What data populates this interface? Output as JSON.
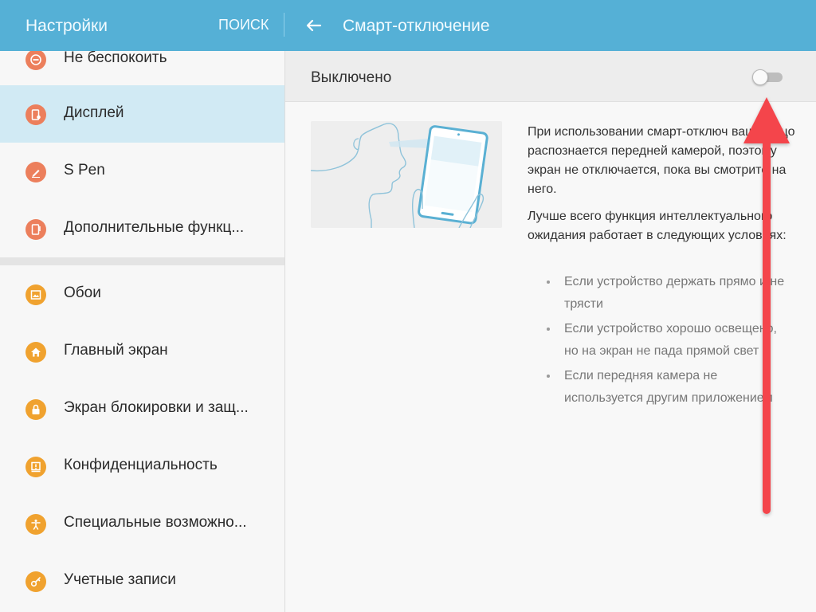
{
  "header": {
    "app_title": "Настройки",
    "search_label": "ПОИСК",
    "page_title": "Смарт-отключение",
    "bg_color": "#55b0d6"
  },
  "sidebar": {
    "items": [
      {
        "label": "Не беспокоить",
        "icon": "do-not-disturb-icon",
        "color": "#ec7f5c"
      },
      {
        "label": "Дисплей",
        "icon": "display-icon",
        "color": "#ec7f5c",
        "active": true
      },
      {
        "label": "S Pen",
        "icon": "pen-icon",
        "color": "#ec7f5c"
      },
      {
        "label": "Дополнительные функц...",
        "icon": "advanced-features-icon",
        "color": "#ec7f5c"
      },
      {
        "label": "Обои",
        "icon": "wallpaper-icon",
        "color": "#f0a22f"
      },
      {
        "label": "Главный экран",
        "icon": "home-icon",
        "color": "#f0a22f"
      },
      {
        "label": "Экран блокировки и защ...",
        "icon": "lock-icon",
        "color": "#f0a22f"
      },
      {
        "label": "Конфиденциальность",
        "icon": "privacy-icon",
        "color": "#f0a22f"
      },
      {
        "label": "Специальные возможно...",
        "icon": "accessibility-icon",
        "color": "#f0a22f"
      },
      {
        "label": "Учетные записи",
        "icon": "key-icon",
        "color": "#f0a22f"
      }
    ]
  },
  "main": {
    "master_switch": {
      "label": "Выключено",
      "state": "off"
    },
    "description": {
      "paragraph1": "При использовании смарт-отключ ваше лицо распознается передней камерой, поэтому экран не отключается, пока вы смотрите на него.",
      "paragraph2": "Лучше всего функция интеллектуального ожидания работает в следующих условиях:"
    },
    "conditions": [
      "Если устройство держать прямо и не трясти",
      "Если устройство хорошо освещено, но на экран не пада прямой свет",
      "Если передняя камера не используется другим приложением"
    ]
  },
  "annotation": {
    "arrow_color": "#f4444b"
  }
}
